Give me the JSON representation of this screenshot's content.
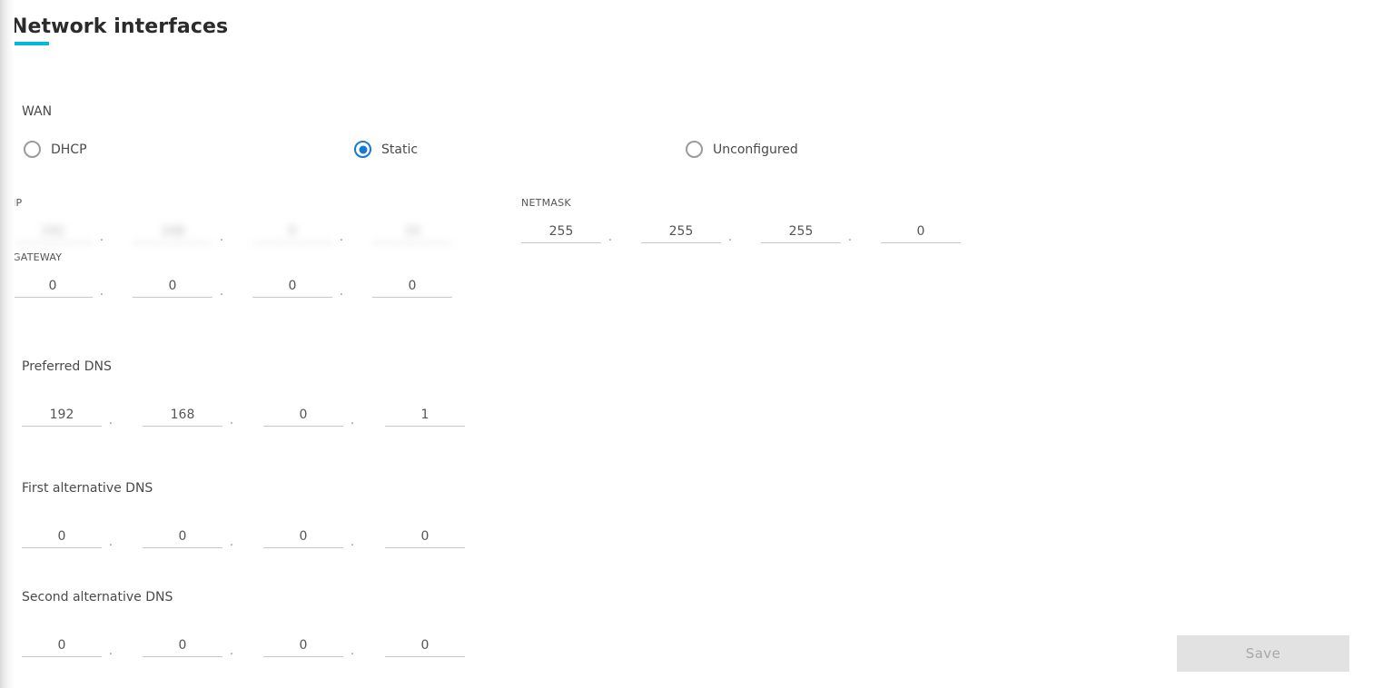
{
  "header": {
    "title": "Network interfaces",
    "accent_color": "#00bcd9"
  },
  "wan": {
    "label": "WAN",
    "mode_options": [
      {
        "label": "DHCP",
        "selected": false
      },
      {
        "label": "Static",
        "selected": true
      },
      {
        "label": "Unconfigured",
        "selected": false
      }
    ],
    "selected_mode": "Static",
    "selected_color": "#1878d2"
  },
  "fields": {
    "ip": {
      "label": "IP",
      "redacted": true,
      "octets": [
        "",
        "",
        "",
        ""
      ]
    },
    "netmask": {
      "label": "NETMASK",
      "redacted": false,
      "octets": [
        "255",
        "255",
        "255",
        "0"
      ]
    },
    "gateway": {
      "label": "GATEWAY",
      "redacted": false,
      "octets": [
        "0",
        "0",
        "0",
        "0"
      ]
    },
    "preferred_dns": {
      "label": "Preferred DNS",
      "redacted": false,
      "octets": [
        "192",
        "168",
        "0",
        "1"
      ]
    },
    "first_alt_dns": {
      "label": "First alternative DNS",
      "redacted": false,
      "octets": [
        "0",
        "0",
        "0",
        "0"
      ]
    },
    "second_alt_dns": {
      "label": "Second alternative DNS",
      "redacted": false,
      "octets": [
        "0",
        "0",
        "0",
        "0"
      ]
    }
  },
  "separator": ".",
  "footer": {
    "save_label": "Save",
    "save_disabled": true
  }
}
